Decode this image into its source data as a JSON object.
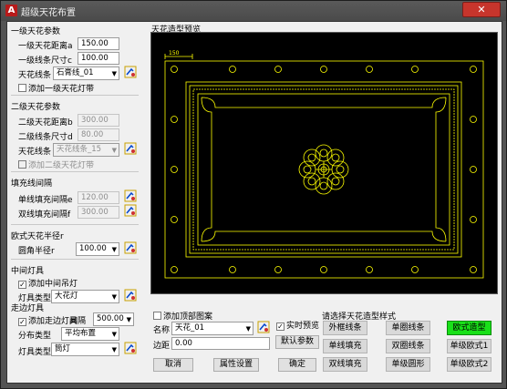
{
  "window": {
    "title": "超级天花布置",
    "app_icon": "A",
    "close": "✕"
  },
  "s1": {
    "header": "一级天花参数",
    "dist_label": "一级天花距离a",
    "dist_value": "150.00",
    "size_label": "一级线条尺寸c",
    "size_value": "100.00",
    "line_label": "天花线条",
    "line_value": "石膏线_01",
    "lightband": "添加一级天花灯带"
  },
  "s2": {
    "header": "二级天花参数",
    "dist_label": "二级天花距离b",
    "dist_value": "300.00",
    "size_label": "二级线条尺寸d",
    "size_value": "80.00",
    "line_label": "天花线条",
    "line_value": "天花线条_15",
    "lightband": "添加二级天花灯带"
  },
  "fill": {
    "header": "填充线间隔",
    "single_label": "单线填充间隔e",
    "single_value": "120.00",
    "double_label": "双线填充间隔f",
    "double_value": "300.00"
  },
  "euro": {
    "header": "欧式天花半径r",
    "radius_label": "圆角半径r",
    "radius_value": "100.00"
  },
  "center": {
    "header": "中间灯具",
    "add": "添加中间吊灯",
    "type_label": "灯具类型",
    "type_value": "大花灯"
  },
  "edge": {
    "header": "走边灯具",
    "add": "添加走边灯具",
    "interval_label": "间隔",
    "interval_value": "500.00",
    "dist_label": "分布类型",
    "dist_value": "平均布置",
    "type_label": "灯具类型",
    "type_value": "筒灯"
  },
  "preview": {
    "label": "天花造型预览",
    "dim_text": "150"
  },
  "pattern": {
    "add": "添加顶部图案",
    "name_label": "名称",
    "name_value": "天花_01",
    "margin_label": "边距",
    "margin_value": "0.00",
    "realtime": "实时预览",
    "default_btn": "默认参数"
  },
  "buttons": {
    "cancel": "取消",
    "props": "属性设置",
    "ok": "确定"
  },
  "styles": {
    "header": "请选择天花造型样式",
    "items": [
      "外框线条",
      "单圈线条",
      "欧式造型",
      "单线填充",
      "双圈线条",
      "单级欧式1",
      "双线填充",
      "单级圆形",
      "单级欧式2"
    ]
  },
  "colors": {
    "accent": "#19e019",
    "preview_line": "#ffff00"
  }
}
